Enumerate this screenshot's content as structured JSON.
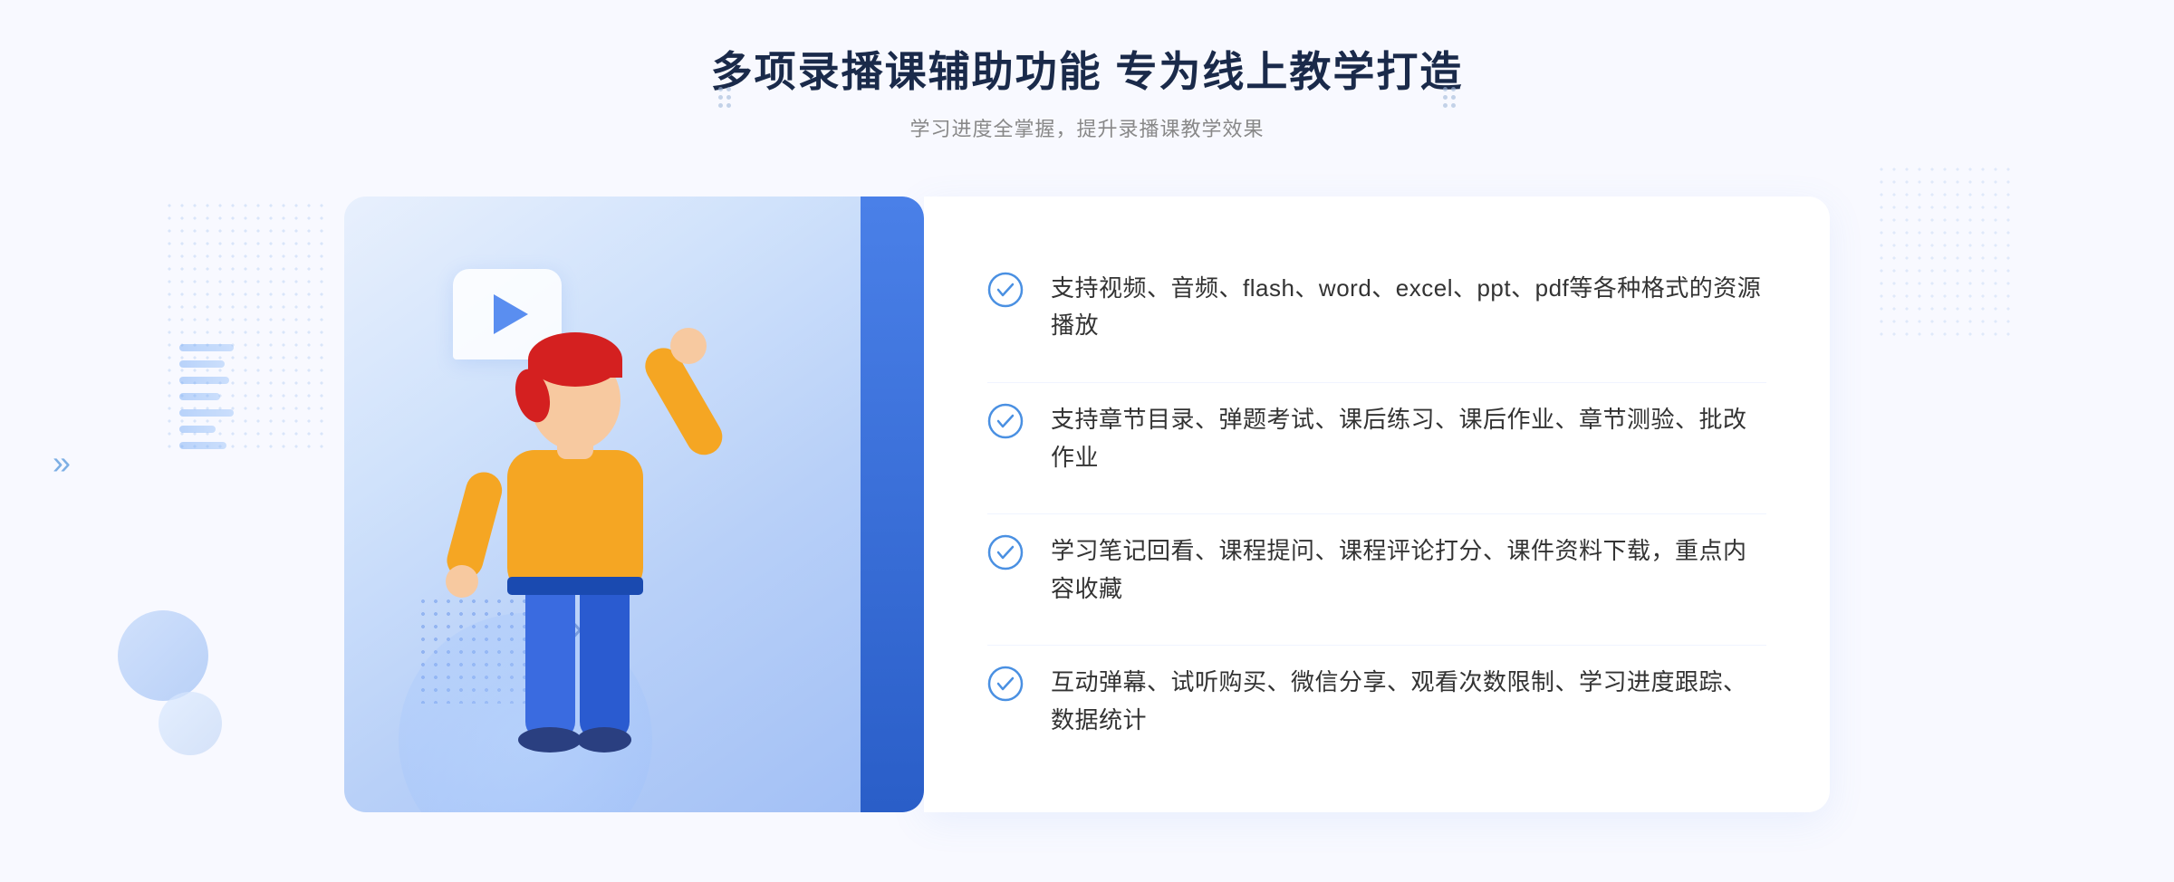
{
  "page": {
    "background": "#f8f9ff"
  },
  "header": {
    "main_title": "多项录播课辅助功能 专为线上教学打造",
    "sub_title": "学习进度全掌握，提升录播课教学效果"
  },
  "features": [
    {
      "id": 1,
      "text": "支持视频、音频、flash、word、excel、ppt、pdf等各种格式的资源播放"
    },
    {
      "id": 2,
      "text": "支持章节目录、弹题考试、课后练习、课后作业、章节测验、批改作业"
    },
    {
      "id": 3,
      "text": "学习笔记回看、课程提问、课程评论打分、课件资料下载，重点内容收藏"
    },
    {
      "id": 4,
      "text": "互动弹幕、试听购买、微信分享、观看次数限制、学习进度跟踪、数据统计"
    }
  ],
  "decoration": {
    "left_arrow": "»",
    "play_icon": "▶"
  }
}
